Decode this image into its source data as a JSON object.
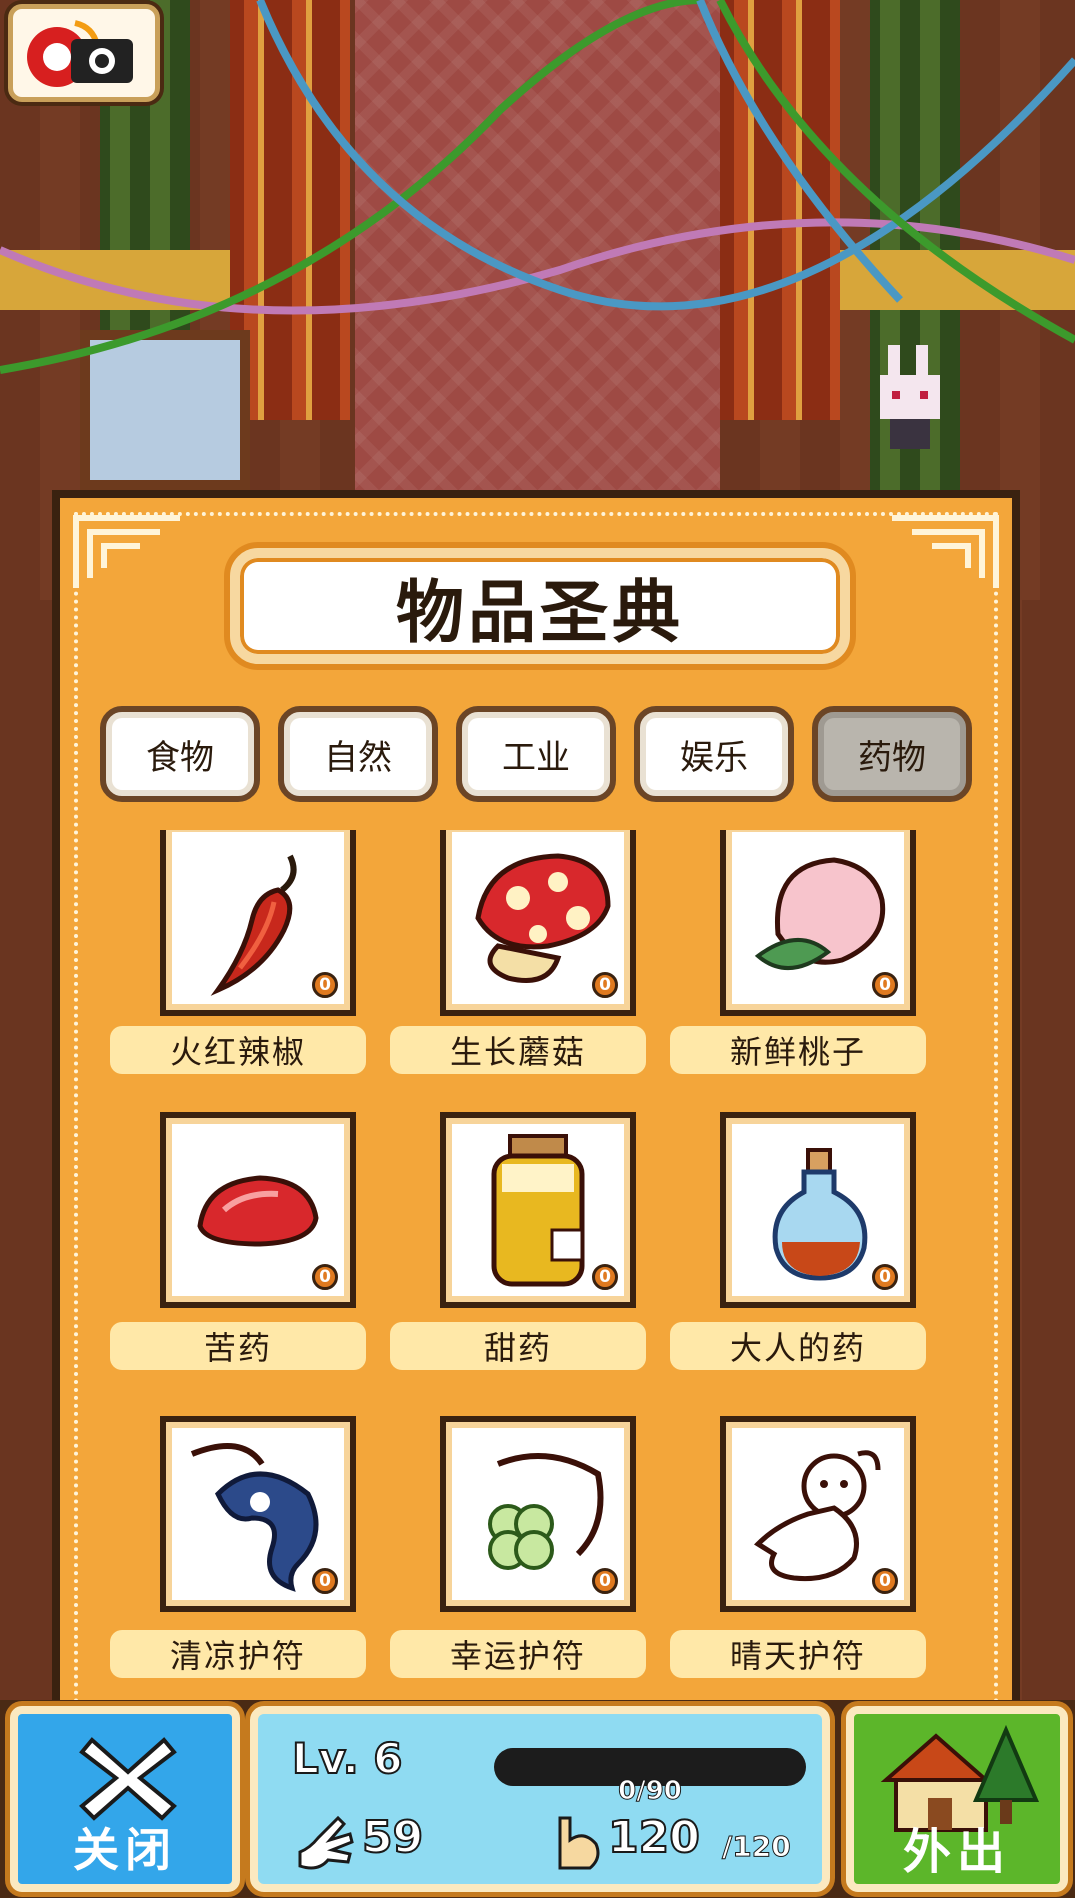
{
  "camera_button": {
    "icon": "camera-icon"
  },
  "book": {
    "title": "物品圣典",
    "tabs": [
      {
        "label": "食物",
        "active": false
      },
      {
        "label": "自然",
        "active": false
      },
      {
        "label": "工业",
        "active": false
      },
      {
        "label": "娱乐",
        "active": false
      },
      {
        "label": "药物",
        "active": true
      }
    ],
    "items": [
      {
        "name": "火红辣椒",
        "count": "0",
        "icon": "red-chili-icon"
      },
      {
        "name": "生长蘑菇",
        "count": "0",
        "icon": "mushroom-icon"
      },
      {
        "name": "新鲜桃子",
        "count": "0",
        "icon": "peach-icon"
      },
      {
        "name": "苦药",
        "count": "0",
        "icon": "red-pill-icon"
      },
      {
        "name": "甜药",
        "count": "0",
        "icon": "honey-jar-icon"
      },
      {
        "name": "大人的药",
        "count": "0",
        "icon": "potion-bottle-icon"
      },
      {
        "name": "清凉护符",
        "count": "0",
        "icon": "blue-charm-icon"
      },
      {
        "name": "幸运护符",
        "count": "0",
        "icon": "clover-charm-icon"
      },
      {
        "name": "晴天护符",
        "count": "0",
        "icon": "teru-teru-bozu-icon"
      }
    ]
  },
  "bottom_bar": {
    "close_label": "关闭",
    "level": "Lv. 6",
    "exp_text": "0/90",
    "exp_fraction": 0,
    "hand_value": "59",
    "stamina_value": "120",
    "stamina_max": "/120",
    "out_label": "外出"
  },
  "colors": {
    "panel": "#f3a63a",
    "label_bg": "#ffe8a8",
    "close_button": "#33a6ea",
    "stats_bg": "#8fdbf2",
    "out_button": "#5cb62a",
    "count_badge": "#e07a20"
  }
}
